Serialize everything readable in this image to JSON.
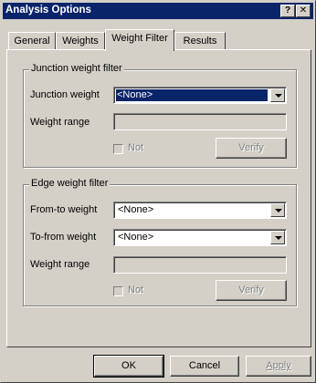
{
  "window": {
    "title": "Analysis Options",
    "help_glyph": "?",
    "close_glyph": "✕",
    "help_icon": "question-mark-icon",
    "close_icon": "close-x-icon",
    "colors": {
      "titlebar": "#0a246a",
      "face": "#d4d0c8",
      "selection": "#0a246a"
    }
  },
  "tabs": [
    {
      "label": "General",
      "active": false
    },
    {
      "label": "Weights",
      "active": false
    },
    {
      "label": "Weight Filter",
      "active": true
    },
    {
      "label": "Results",
      "active": false
    }
  ],
  "junction_filter": {
    "legend": "Junction weight filter",
    "weight_label": "Junction weight",
    "weight_value": "<None>",
    "range_label": "Weight range",
    "range_value": "",
    "not_label": "Not",
    "not_checked": false,
    "verify_label": "Verify"
  },
  "edge_filter": {
    "legend": "Edge weight filter",
    "from_to_label": "From-to weight",
    "from_to_value": "<None>",
    "to_from_label": "To-from weight",
    "to_from_value": "<None>",
    "range_label": "Weight range",
    "range_value": "",
    "not_label": "Not",
    "not_checked": false,
    "verify_label": "Verify"
  },
  "footer": {
    "ok_label": "OK",
    "cancel_label": "Cancel",
    "apply_label": "Apply"
  }
}
